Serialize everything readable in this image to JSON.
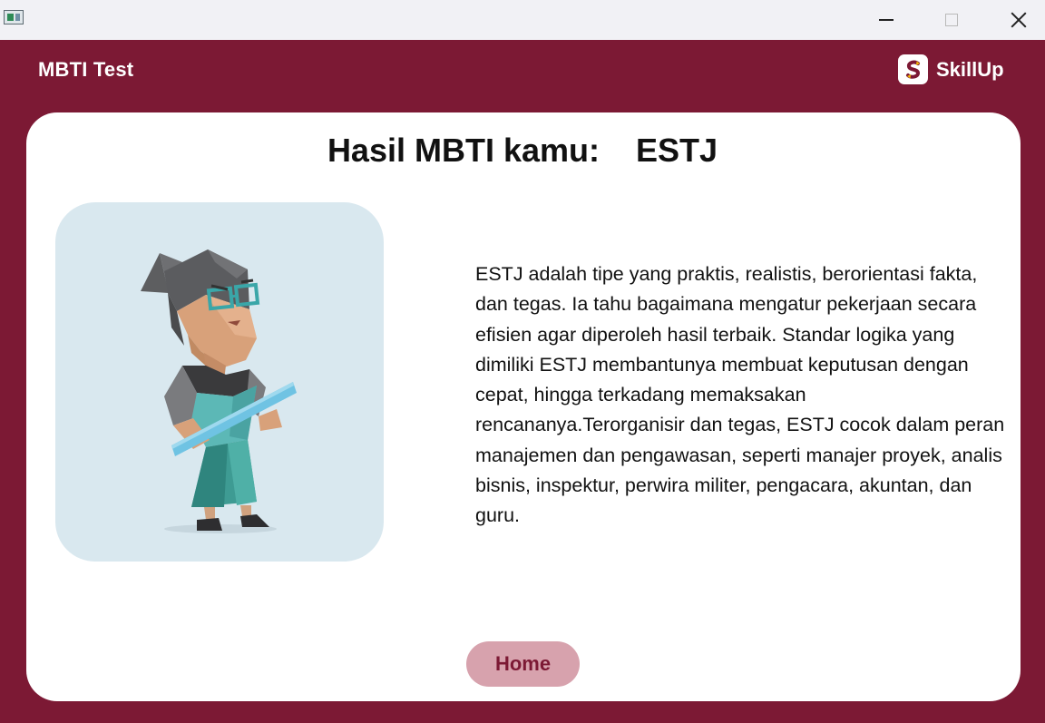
{
  "window": {
    "icon": "app-window-icon",
    "controls": [
      "minimize-icon",
      "maximize-icon",
      "close-icon"
    ]
  },
  "header": {
    "title": "MBTI Test",
    "brand_name": "SkillUp",
    "brand_icon": "skillup-logo-icon"
  },
  "result": {
    "heading_label": "Hasil MBTI kamu:",
    "type": "ESTJ",
    "illustration": "teacher-character-illustration",
    "description": "ESTJ adalah tipe yang praktis, realistis, berorientasi fakta, dan tegas. Ia tahu bagaimana mengatur pekerjaan secara efisien agar diperoleh hasil terbaik. Standar logika yang dimiliki ESTJ membantunya membuat keputusan dengan cepat, hingga terkadang memaksakan rencananya.Terorganisir dan tegas, ESTJ cocok dalam peran manajemen dan pengawasan, seperti manajer proyek, analis bisnis, inspektur, perwira militer, pengacara, akuntan, dan guru."
  },
  "actions": {
    "home_label": "Home"
  },
  "colors": {
    "brand": "#7c1934",
    "button_bg": "#d7a2ad",
    "card": "#ffffff",
    "illustration_bg": "#d9e8ef"
  }
}
